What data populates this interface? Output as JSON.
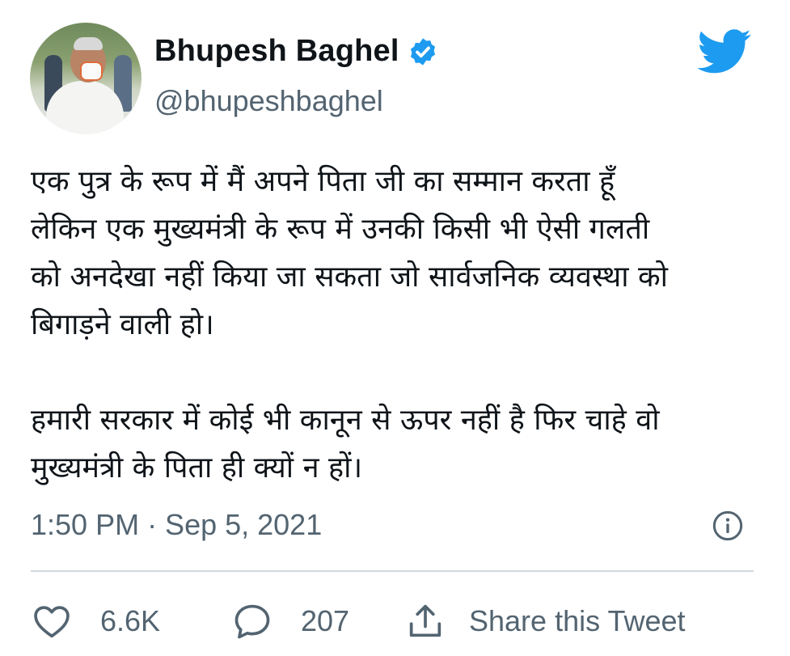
{
  "author": {
    "display_name": "Bhupesh Baghel",
    "handle": "@bhupeshbaghel",
    "verified": true,
    "verified_color": "#1d9bf0"
  },
  "brand": {
    "logo": "twitter-bird-icon",
    "color": "#1d9bf0"
  },
  "tweet": {
    "text": "एक पुत्र के रूप में मैं अपने पिता जी का सम्मान करता हूँ\nलेकिन एक मुख्यमंत्री के रूप में उनकी किसी भी ऐसी गलती\nको अनदेखा नहीं किया जा सकता जो सार्वजनिक व्यवस्था को\nबिगाड़ने वाली हो।\n\nहमारी सरकार में कोई भी कानून से ऊपर नहीं है फिर चाहे वो\nमुख्यमंत्री के पिता ही क्यों न हों।",
    "timestamp": "1:50 PM · Sep 5, 2021"
  },
  "actions": {
    "like": {
      "icon": "heart-icon",
      "count": "6.6K"
    },
    "reply": {
      "icon": "speech-bubble-icon",
      "count": "207"
    },
    "share": {
      "icon": "share-upload-icon",
      "label": "Share this Tweet"
    }
  },
  "info_icon": "info-icon",
  "colors": {
    "text_primary": "#0f1419",
    "text_secondary": "#536471",
    "divider": "#cfd9de"
  }
}
